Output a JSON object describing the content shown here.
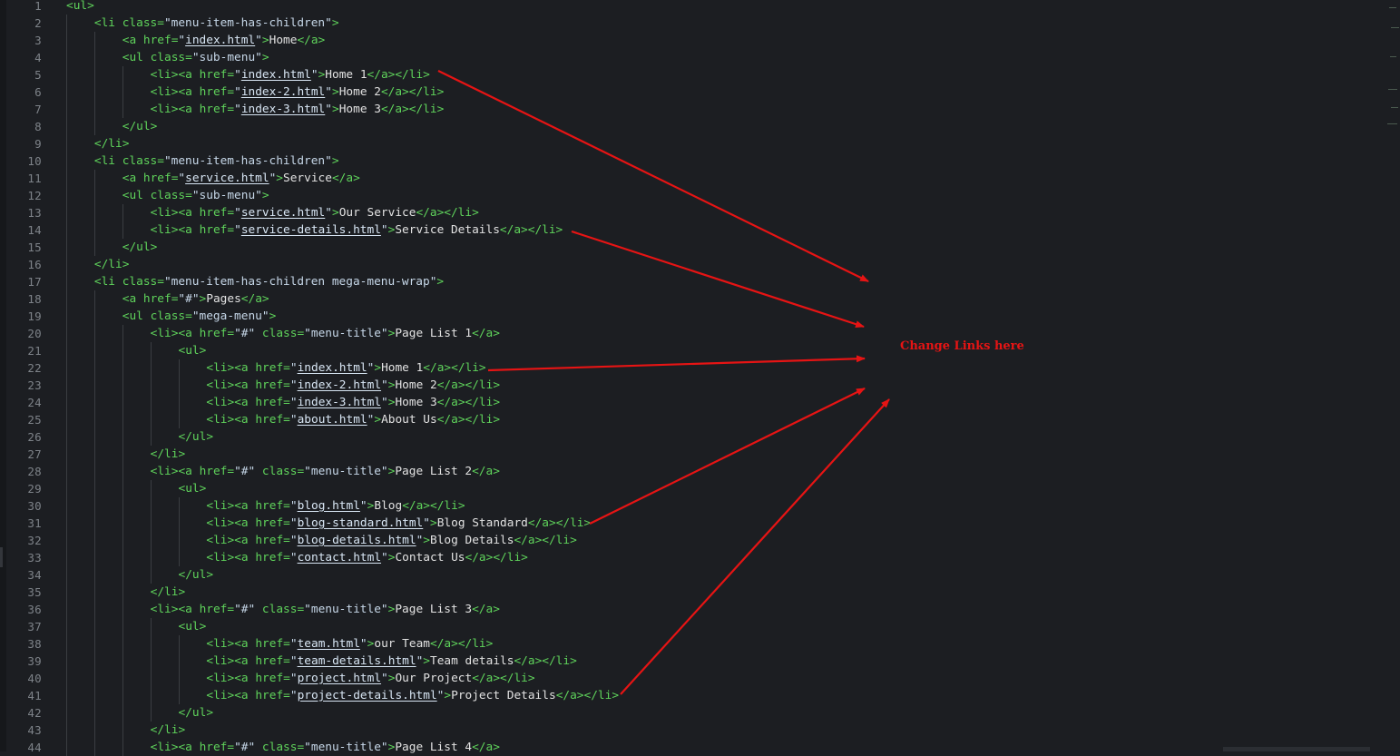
{
  "annotation": {
    "label": "Change Links here",
    "color": "#e61414"
  },
  "lines": [
    {
      "n": "1",
      "indent": 0,
      "code": [
        [
          "t",
          "<ul>"
        ]
      ]
    },
    {
      "n": "2",
      "indent": 1,
      "code": [
        [
          "t",
          "<li "
        ],
        [
          "a",
          "class="
        ],
        [
          "s",
          "\"menu-item-has-children\""
        ],
        [
          "t",
          ">"
        ]
      ]
    },
    {
      "n": "3",
      "indent": 2,
      "code": [
        [
          "t",
          "<a "
        ],
        [
          "a",
          "href="
        ],
        [
          "s",
          "\""
        ],
        [
          "u",
          "index.html"
        ],
        [
          "s",
          "\""
        ],
        [
          "t",
          ">"
        ],
        [
          "x",
          "Home"
        ],
        [
          "t",
          "</a>"
        ]
      ]
    },
    {
      "n": "4",
      "indent": 2,
      "code": [
        [
          "t",
          "<ul "
        ],
        [
          "a",
          "class="
        ],
        [
          "s",
          "\"sub-menu\""
        ],
        [
          "t",
          ">"
        ]
      ]
    },
    {
      "n": "5",
      "indent": 3,
      "code": [
        [
          "t",
          "<li><a "
        ],
        [
          "a",
          "href="
        ],
        [
          "s",
          "\""
        ],
        [
          "u",
          "index.html"
        ],
        [
          "s",
          "\""
        ],
        [
          "t",
          ">"
        ],
        [
          "x",
          "Home 1"
        ],
        [
          "t",
          "</a></li>"
        ]
      ]
    },
    {
      "n": "6",
      "indent": 3,
      "code": [
        [
          "t",
          "<li><a "
        ],
        [
          "a",
          "href="
        ],
        [
          "s",
          "\""
        ],
        [
          "u",
          "index-2.html"
        ],
        [
          "s",
          "\""
        ],
        [
          "t",
          ">"
        ],
        [
          "x",
          "Home 2"
        ],
        [
          "t",
          "</a></li>"
        ]
      ]
    },
    {
      "n": "7",
      "indent": 3,
      "code": [
        [
          "t",
          "<li><a "
        ],
        [
          "a",
          "href="
        ],
        [
          "s",
          "\""
        ],
        [
          "u",
          "index-3.html"
        ],
        [
          "s",
          "\""
        ],
        [
          "t",
          ">"
        ],
        [
          "x",
          "Home 3"
        ],
        [
          "t",
          "</a></li>"
        ]
      ]
    },
    {
      "n": "8",
      "indent": 2,
      "code": [
        [
          "t",
          "</ul>"
        ]
      ]
    },
    {
      "n": "9",
      "indent": 1,
      "code": [
        [
          "t",
          "</li>"
        ]
      ]
    },
    {
      "n": "10",
      "indent": 1,
      "code": [
        [
          "t",
          "<li "
        ],
        [
          "a",
          "class="
        ],
        [
          "s",
          "\"menu-item-has-children\""
        ],
        [
          "t",
          ">"
        ]
      ]
    },
    {
      "n": "11",
      "indent": 2,
      "code": [
        [
          "t",
          "<a "
        ],
        [
          "a",
          "href="
        ],
        [
          "s",
          "\""
        ],
        [
          "u",
          "service.html"
        ],
        [
          "s",
          "\""
        ],
        [
          "t",
          ">"
        ],
        [
          "x",
          "Service"
        ],
        [
          "t",
          "</a>"
        ]
      ]
    },
    {
      "n": "12",
      "indent": 2,
      "code": [
        [
          "t",
          "<ul "
        ],
        [
          "a",
          "class="
        ],
        [
          "s",
          "\"sub-menu\""
        ],
        [
          "t",
          ">"
        ]
      ]
    },
    {
      "n": "13",
      "indent": 3,
      "code": [
        [
          "t",
          "<li><a "
        ],
        [
          "a",
          "href="
        ],
        [
          "s",
          "\""
        ],
        [
          "u",
          "service.html"
        ],
        [
          "s",
          "\""
        ],
        [
          "t",
          ">"
        ],
        [
          "x",
          "Our Service"
        ],
        [
          "t",
          "</a></li>"
        ]
      ]
    },
    {
      "n": "14",
      "indent": 3,
      "code": [
        [
          "t",
          "<li><a "
        ],
        [
          "a",
          "href="
        ],
        [
          "s",
          "\""
        ],
        [
          "u",
          "service-details.html"
        ],
        [
          "s",
          "\""
        ],
        [
          "t",
          ">"
        ],
        [
          "x",
          "Service Details"
        ],
        [
          "t",
          "</a></li>"
        ]
      ]
    },
    {
      "n": "15",
      "indent": 2,
      "code": [
        [
          "t",
          "</ul>"
        ]
      ]
    },
    {
      "n": "16",
      "indent": 1,
      "code": [
        [
          "t",
          "</li>"
        ]
      ]
    },
    {
      "n": "17",
      "indent": 1,
      "code": [
        [
          "t",
          "<li "
        ],
        [
          "a",
          "class="
        ],
        [
          "s",
          "\"menu-item-has-children mega-menu-wrap\""
        ],
        [
          "t",
          ">"
        ]
      ]
    },
    {
      "n": "18",
      "indent": 2,
      "code": [
        [
          "t",
          "<a "
        ],
        [
          "a",
          "href="
        ],
        [
          "s",
          "\"#\""
        ],
        [
          "t",
          ">"
        ],
        [
          "x",
          "Pages"
        ],
        [
          "t",
          "</a>"
        ]
      ]
    },
    {
      "n": "19",
      "indent": 2,
      "code": [
        [
          "t",
          "<ul "
        ],
        [
          "a",
          "class="
        ],
        [
          "s",
          "\"mega-menu\""
        ],
        [
          "t",
          ">"
        ]
      ]
    },
    {
      "n": "20",
      "indent": 3,
      "code": [
        [
          "t",
          "<li><a "
        ],
        [
          "a",
          "href="
        ],
        [
          "s",
          "\"#\""
        ],
        [
          "a",
          " class="
        ],
        [
          "s",
          "\"menu-title\""
        ],
        [
          "t",
          ">"
        ],
        [
          "x",
          "Page List 1"
        ],
        [
          "t",
          "</a>"
        ]
      ]
    },
    {
      "n": "21",
      "indent": 4,
      "code": [
        [
          "t",
          "<ul>"
        ]
      ]
    },
    {
      "n": "22",
      "indent": 5,
      "code": [
        [
          "t",
          "<li><a "
        ],
        [
          "a",
          "href="
        ],
        [
          "s",
          "\""
        ],
        [
          "u",
          "index.html"
        ],
        [
          "s",
          "\""
        ],
        [
          "t",
          ">"
        ],
        [
          "x",
          "Home 1"
        ],
        [
          "t",
          "</a></li>"
        ]
      ]
    },
    {
      "n": "23",
      "indent": 5,
      "code": [
        [
          "t",
          "<li><a "
        ],
        [
          "a",
          "href="
        ],
        [
          "s",
          "\""
        ],
        [
          "u",
          "index-2.html"
        ],
        [
          "s",
          "\""
        ],
        [
          "t",
          ">"
        ],
        [
          "x",
          "Home 2"
        ],
        [
          "t",
          "</a></li>"
        ]
      ]
    },
    {
      "n": "24",
      "indent": 5,
      "code": [
        [
          "t",
          "<li><a "
        ],
        [
          "a",
          "href="
        ],
        [
          "s",
          "\""
        ],
        [
          "u",
          "index-3.html"
        ],
        [
          "s",
          "\""
        ],
        [
          "t",
          ">"
        ],
        [
          "x",
          "Home 3"
        ],
        [
          "t",
          "</a></li>"
        ]
      ]
    },
    {
      "n": "25",
      "indent": 5,
      "code": [
        [
          "t",
          "<li><a "
        ],
        [
          "a",
          "href="
        ],
        [
          "s",
          "\""
        ],
        [
          "u",
          "about.html"
        ],
        [
          "s",
          "\""
        ],
        [
          "t",
          ">"
        ],
        [
          "x",
          "About Us"
        ],
        [
          "t",
          "</a></li>"
        ]
      ]
    },
    {
      "n": "26",
      "indent": 4,
      "code": [
        [
          "t",
          "</ul>"
        ]
      ]
    },
    {
      "n": "27",
      "indent": 3,
      "code": [
        [
          "t",
          "</li>"
        ]
      ]
    },
    {
      "n": "28",
      "indent": 3,
      "code": [
        [
          "t",
          "<li><a "
        ],
        [
          "a",
          "href="
        ],
        [
          "s",
          "\"#\""
        ],
        [
          "a",
          " class="
        ],
        [
          "s",
          "\"menu-title\""
        ],
        [
          "t",
          ">"
        ],
        [
          "x",
          "Page List 2"
        ],
        [
          "t",
          "</a>"
        ]
      ]
    },
    {
      "n": "29",
      "indent": 4,
      "code": [
        [
          "t",
          "<ul>"
        ]
      ]
    },
    {
      "n": "30",
      "indent": 5,
      "code": [
        [
          "t",
          "<li><a "
        ],
        [
          "a",
          "href="
        ],
        [
          "s",
          "\""
        ],
        [
          "u",
          "blog.html"
        ],
        [
          "s",
          "\""
        ],
        [
          "t",
          ">"
        ],
        [
          "x",
          "Blog"
        ],
        [
          "t",
          "</a></li>"
        ]
      ]
    },
    {
      "n": "31",
      "indent": 5,
      "code": [
        [
          "t",
          "<li><a "
        ],
        [
          "a",
          "href="
        ],
        [
          "s",
          "\""
        ],
        [
          "u",
          "blog-standard.html"
        ],
        [
          "s",
          "\""
        ],
        [
          "t",
          ">"
        ],
        [
          "x",
          "Blog Standard"
        ],
        [
          "t",
          "</a></li>"
        ]
      ]
    },
    {
      "n": "32",
      "indent": 5,
      "code": [
        [
          "t",
          "<li><a "
        ],
        [
          "a",
          "href="
        ],
        [
          "s",
          "\""
        ],
        [
          "u",
          "blog-details.html"
        ],
        [
          "s",
          "\""
        ],
        [
          "t",
          ">"
        ],
        [
          "x",
          "Blog Details"
        ],
        [
          "t",
          "</a></li>"
        ]
      ]
    },
    {
      "n": "33",
      "indent": 5,
      "code": [
        [
          "t",
          "<li><a "
        ],
        [
          "a",
          "href="
        ],
        [
          "s",
          "\""
        ],
        [
          "u",
          "contact.html"
        ],
        [
          "s",
          "\""
        ],
        [
          "t",
          ">"
        ],
        [
          "x",
          "Contact Us"
        ],
        [
          "t",
          "</a></li>"
        ]
      ]
    },
    {
      "n": "34",
      "indent": 4,
      "code": [
        [
          "t",
          "</ul>"
        ]
      ]
    },
    {
      "n": "35",
      "indent": 3,
      "code": [
        [
          "t",
          "</li>"
        ]
      ]
    },
    {
      "n": "36",
      "indent": 3,
      "code": [
        [
          "t",
          "<li><a "
        ],
        [
          "a",
          "href="
        ],
        [
          "s",
          "\"#\""
        ],
        [
          "a",
          " class="
        ],
        [
          "s",
          "\"menu-title\""
        ],
        [
          "t",
          ">"
        ],
        [
          "x",
          "Page List 3"
        ],
        [
          "t",
          "</a>"
        ]
      ]
    },
    {
      "n": "37",
      "indent": 4,
      "code": [
        [
          "t",
          "<ul>"
        ]
      ]
    },
    {
      "n": "38",
      "indent": 5,
      "code": [
        [
          "t",
          "<li><a "
        ],
        [
          "a",
          "href="
        ],
        [
          "s",
          "\""
        ],
        [
          "u",
          "team.html"
        ],
        [
          "s",
          "\""
        ],
        [
          "t",
          ">"
        ],
        [
          "x",
          "our Team"
        ],
        [
          "t",
          "</a></li>"
        ]
      ]
    },
    {
      "n": "39",
      "indent": 5,
      "code": [
        [
          "t",
          "<li><a "
        ],
        [
          "a",
          "href="
        ],
        [
          "s",
          "\""
        ],
        [
          "u",
          "team-details.html"
        ],
        [
          "s",
          "\""
        ],
        [
          "t",
          ">"
        ],
        [
          "x",
          "Team details"
        ],
        [
          "t",
          "</a></li>"
        ]
      ]
    },
    {
      "n": "40",
      "indent": 5,
      "code": [
        [
          "t",
          "<li><a "
        ],
        [
          "a",
          "href="
        ],
        [
          "s",
          "\""
        ],
        [
          "u",
          "project.html"
        ],
        [
          "s",
          "\""
        ],
        [
          "t",
          ">"
        ],
        [
          "x",
          "Our Project"
        ],
        [
          "t",
          "</a></li>"
        ]
      ]
    },
    {
      "n": "41",
      "indent": 5,
      "code": [
        [
          "t",
          "<li><a "
        ],
        [
          "a",
          "href="
        ],
        [
          "s",
          "\""
        ],
        [
          "u",
          "project-details.html"
        ],
        [
          "s",
          "\""
        ],
        [
          "t",
          ">"
        ],
        [
          "x",
          "Project Details"
        ],
        [
          "t",
          "</a></li>"
        ]
      ]
    },
    {
      "n": "42",
      "indent": 4,
      "code": [
        [
          "t",
          "</ul>"
        ]
      ]
    },
    {
      "n": "43",
      "indent": 3,
      "code": [
        [
          "t",
          "</li>"
        ]
      ]
    },
    {
      "n": "44",
      "indent": 3,
      "code": [
        [
          "t",
          "<li><a "
        ],
        [
          "a",
          "href="
        ],
        [
          "s",
          "\"#\""
        ],
        [
          "a",
          " class="
        ],
        [
          "s",
          "\"menu-title\""
        ],
        [
          "t",
          ">"
        ],
        [
          "x",
          "Page List 4"
        ],
        [
          "t",
          "</a>"
        ]
      ]
    }
  ]
}
